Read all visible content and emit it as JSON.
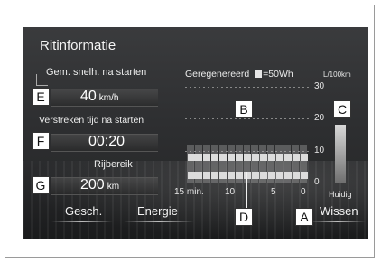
{
  "screen": {
    "title": "Ritinformatie"
  },
  "stats": {
    "avg_speed_label": "Gem. snelh. na starten",
    "avg_speed_value": "40",
    "avg_speed_unit": "km/h",
    "elapsed_label": "Verstreken tijd na starten",
    "elapsed_value": "00:20",
    "range_label": "Rijbereik",
    "range_value": "200",
    "range_unit": "km"
  },
  "chart_data": {
    "type": "bar",
    "legend_text": "Geregenereerd",
    "legend_value": "=50Wh",
    "unit_label": "L/100km",
    "y_ticks": [
      "30",
      "20",
      "10",
      "0"
    ],
    "x_ticks": [
      "15 min.",
      "10",
      "5",
      "0"
    ],
    "current_label": "Huidig",
    "regen_icons_per_minute": [
      1,
      1,
      1,
      1,
      1,
      1,
      1,
      1,
      1,
      1,
      1,
      1,
      1,
      1,
      1
    ],
    "consumption_per_minute": [
      12,
      12,
      12,
      12,
      12,
      12,
      12,
      12,
      12,
      12,
      12,
      12,
      12,
      12,
      12
    ],
    "current_consumption": 19
  },
  "buttons": {
    "history": "Gesch.",
    "energy": "Energie",
    "clear": "Wissen"
  },
  "callouts": {
    "a": "A",
    "b": "B",
    "c": "C",
    "d": "D",
    "e": "E",
    "f": "F",
    "g": "G"
  }
}
